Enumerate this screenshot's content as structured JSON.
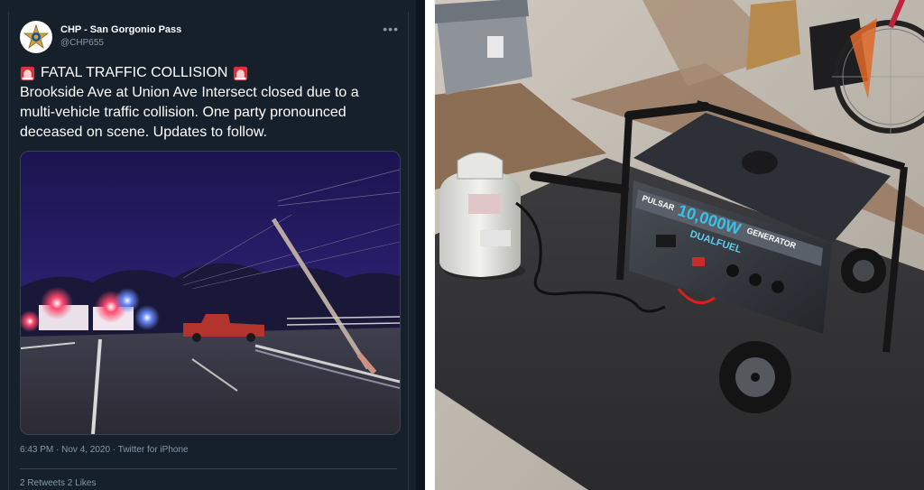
{
  "tweet": {
    "display_name": "CHP - San Gorgonio Pass",
    "handle": "@CHP655",
    "more_icon": "more-icon",
    "headline": "FATAL TRAFFIC COLLISION",
    "body": "Brookside Ave at Union Ave Intersect closed due to a multi-vehicle traffic collision. One party pronounced deceased on scene. Updates to follow.",
    "meta": "6:43 PM · Nov 4, 2020 · Twitter for iPhone",
    "stats": "2 Retweets   2 Likes",
    "media_icon": "night-road-scene",
    "siren_icon": "rotating-light-icon"
  },
  "photo": {
    "subject_icon": "generator-photo",
    "generator_badge": "10,000W",
    "generator_model": "GENERATOR",
    "generator_fuel": "DUALFUEL",
    "brand": "PULSAR"
  }
}
